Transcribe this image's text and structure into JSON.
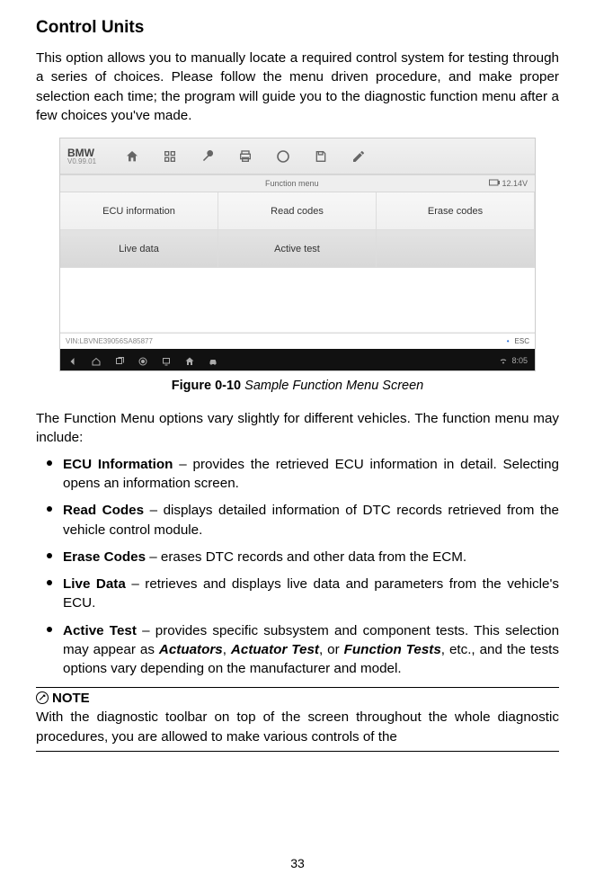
{
  "heading": "Control Units",
  "intro": "This option allows you to manually locate a required control system for testing through a series of choices. Please follow the menu driven procedure, and make proper selection each time; the program will guide you to the diagnostic function menu after a few choices you've made.",
  "figure": {
    "brand": "BMW",
    "brandSub": "V0.99.01",
    "funcbar_title": "Function menu",
    "battery": "12.14V",
    "cells": {
      "r1c1": "ECU information",
      "r1c2": "Read codes",
      "r1c3": "Erase codes",
      "r2c1": "Live data",
      "r2c2": "Active test",
      "r2c3": ""
    },
    "vin": "VIN:LBVNE39056SA85877",
    "esc": "ESC",
    "time_top": "",
    "time_bottom": "8:05"
  },
  "caption": {
    "label": "Figure 0-10 ",
    "desc": "Sample Function Menu Screen"
  },
  "paraAfter": "The Function Menu options vary slightly for different vehicles. The function menu may include:",
  "items": [
    {
      "term": "ECU Information",
      "sep": " – ",
      "desc": "provides the retrieved ECU information in detail. Selecting opens an information screen."
    },
    {
      "term": "Read Codes",
      "sep": " – ",
      "desc": "displays detailed information of DTC records retrieved from the vehicle control module."
    },
    {
      "term": "Erase Codes",
      "sep": " – ",
      "desc": "erases DTC records and other data from the ECM."
    },
    {
      "term": "Live Data",
      "sep": " – ",
      "desc": "retrieves and displays live data and parameters from the vehicle's ECU."
    },
    {
      "term": "Active Test",
      "sep": " – ",
      "desc1": "provides specific subsystem and component tests. This selection may appear as ",
      "alt1": "Actuators",
      "c1": ", ",
      "alt2": "Actuator Test",
      "c2": ", or ",
      "alt3": "Function Tests",
      "desc2": ", etc., and the tests options vary depending on the manufacturer and model."
    }
  ],
  "note": {
    "title": "NOTE",
    "text": "With the diagnostic toolbar on top of the screen throughout the whole diagnostic procedures, you are allowed to make various controls of the"
  },
  "pageNum": "33"
}
